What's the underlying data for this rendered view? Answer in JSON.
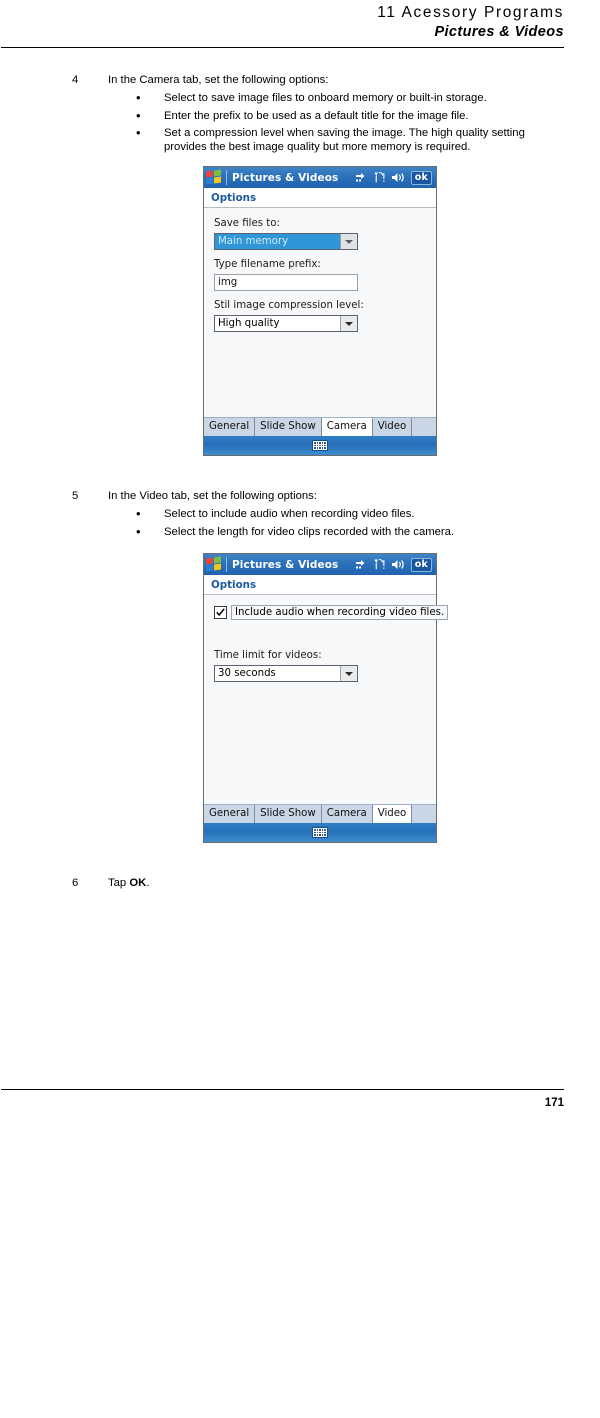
{
  "header": {
    "line1": "11 Acessory Programs",
    "line2": "Pictures & Videos"
  },
  "steps": [
    {
      "number": "4",
      "text": "In the Camera tab, set the following options:",
      "bullets": [
        "Select to save image files to onboard memory or built-in storage.",
        "Enter the prefix to be used as a default title for the image file.",
        "Set a compression level when saving the image. The high quality setting provides the best image quality but more memory is required."
      ]
    },
    {
      "number": "5",
      "text": "In the Video tab, set the following options:",
      "bullets": [
        "Select to include audio when recording video files.",
        "Select the length for video clips recorded with the camera."
      ]
    },
    {
      "number": "6",
      "text_before": "Tap ",
      "text_bold": "OK",
      "text_after": "."
    }
  ],
  "screenshot_camera": {
    "titlebar": {
      "title": "Pictures & Videos",
      "logo": "windows-flag-icon",
      "icons": [
        "connectivity-icon",
        "signal-strength-icon",
        "volume-icon"
      ],
      "ok_label": "ok"
    },
    "options_label": "Options",
    "fields": {
      "save_files_label": "Save files to:",
      "save_files_value": "Main memory",
      "prefix_label": "Type filename prefix:",
      "prefix_value": "img",
      "compression_label": "Stil image compression level:",
      "compression_value": "High quality"
    },
    "tabs": [
      {
        "label": "General",
        "active": false
      },
      {
        "label": "Slide Show",
        "active": false
      },
      {
        "label": "Camera",
        "active": true
      },
      {
        "label": "Video",
        "active": false
      }
    ],
    "sip_icon": "keyboard-icon"
  },
  "screenshot_video": {
    "titlebar": {
      "title": "Pictures & Videos",
      "logo": "windows-flag-icon",
      "icons": [
        "connectivity-icon",
        "signal-strength-icon",
        "volume-icon"
      ],
      "ok_label": "ok"
    },
    "options_label": "Options",
    "fields": {
      "include_audio_label": "Include audio when recording video files.",
      "include_audio_checked": true,
      "time_limit_label": "Time limit for videos:",
      "time_limit_value": "30 seconds"
    },
    "tabs": [
      {
        "label": "General",
        "active": false
      },
      {
        "label": "Slide Show",
        "active": false
      },
      {
        "label": "Camera",
        "active": false
      },
      {
        "label": "Video",
        "active": true
      }
    ],
    "sip_icon": "keyboard-icon"
  },
  "footer": {
    "page_number": "171"
  },
  "colors": {
    "titlebar_blue": "#2d72bb",
    "options_text": "#1b5a9e",
    "selection_blue": "#2f97d8",
    "tabstrip": "#c9d6e5"
  }
}
